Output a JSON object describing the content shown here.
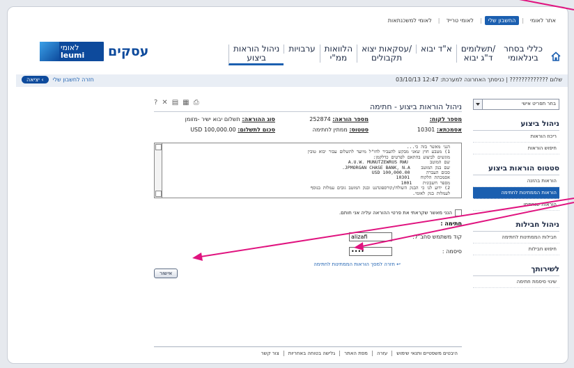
{
  "topbar": {
    "links": [
      "אתר לאומי",
      "החשבון שלי",
      "לאומי טרייד",
      "לאומי למשכנתאות"
    ],
    "active_index": 1
  },
  "nav": {
    "items": [
      "כללי בסחר\nבינלאומי",
      "תשלומים/\nד\"ג יבוא",
      "א\"ד יבוא",
      "עסקאות יצוא/\nתקבולים",
      "הלוואות\nממ\"י",
      "ערבויות",
      "ניהול הוראות\nביצוע"
    ],
    "selected_index": 6,
    "brand": "עסקים",
    "logo_top": "לאומי",
    "logo_bottom": "leumi",
    "home_icon": "home-icon"
  },
  "status": {
    "greeting": "שלום ????????????? | כניסתך האחרונה למערכת: 12:47 03/10/13",
    "back_link": "חזרה לחשבון שלי",
    "exit_label": "יציאה"
  },
  "sidebar": {
    "select_label": "בחר תפריט אישי",
    "sections": [
      {
        "title": "ניהול ביצוע",
        "items": [
          "ריכוז הוראות",
          "חיפוש הוראות"
        ]
      },
      {
        "title": "סטטוס הוראות ביצוע",
        "items": [
          "הוראות בהזנה",
          "הוראות הממתינות לחתימה",
          "הוראות שנחתמו"
        ]
      },
      {
        "title": "ניהול חבילות",
        "items": [
          "חבילות הממתינות לחתימה",
          "חיפוש חבילות"
        ]
      },
      {
        "title": "לשירותך",
        "items": [
          "שינוי סיסמת חתימה"
        ]
      }
    ],
    "selected_item": "הוראות הממתינות לחתימה"
  },
  "content": {
    "title": "ניהול הוראות ביצוע - חתימה",
    "toolbar_icons": [
      "help-icon",
      "close-icon",
      "save-icon",
      "calculator-icon",
      "print-icon"
    ],
    "customer_label": "מספר לקוח:",
    "customer_value": "",
    "instruction_no_label": "מספר הוראה:",
    "instruction_no_value": "252874",
    "instruction_type_label": "סוג ההוראה:",
    "instruction_type_value": "תשלום יבוא ישיר -מזומן",
    "account_label": "אסמכתא:",
    "account_value": "10301",
    "status_label": "סטטוס:",
    "status_value": "ממתין לחתימה",
    "amount_label": "סכום לתשלום:",
    "amount_value": "USD 100,000.00",
    "text_body": "הנני מאשר בזה כי...\n1) מטבע חוץ שאני מבקש להעביר לחו\"ל מיועד לתשלום עבור יבוא טובין\nמוגשים לביצוע בהתאם לפרטים כדלקמן:\nשם המוטב        A.U.W. MUNUTZEWRUS RWU\nשם בנק המוטב    JPMORGAN CHASE BANK, N.A.\nסכום העברה      USD 100,000.00\nאסמכתת הלקוח    10301\nמספר חשבונית    1001\n2) ידוע לנו כי הבנק השולח/קורספונדנט ובנק המוטב גובים עמלות בנוסף\nלעמלות בנק לאומי.",
    "confirm_text": "הנני מאשר שקראתי את פרטי ההוראה עליה אני חותם.",
    "sign_heading": "חתימה :",
    "username_label": "קוד משתמש סחב\"ל:",
    "username_value": "alizafi",
    "password_label": "סיסמה :",
    "password_value": "••••",
    "back_link": "חזרה למסך הוראות הממתינות לחתימה",
    "ok_label": "אישור"
  },
  "footer": {
    "links": [
      "היבטים משפטיים ותנאי שימוש",
      "עזרה",
      "מפת האתר",
      "גלישה בטוחה באחריות",
      "צור קשר"
    ]
  },
  "colors": {
    "brand_blue": "#0d4a9c",
    "accent_blue": "#1b5fb0",
    "arrow_magenta": "#e0137f"
  }
}
